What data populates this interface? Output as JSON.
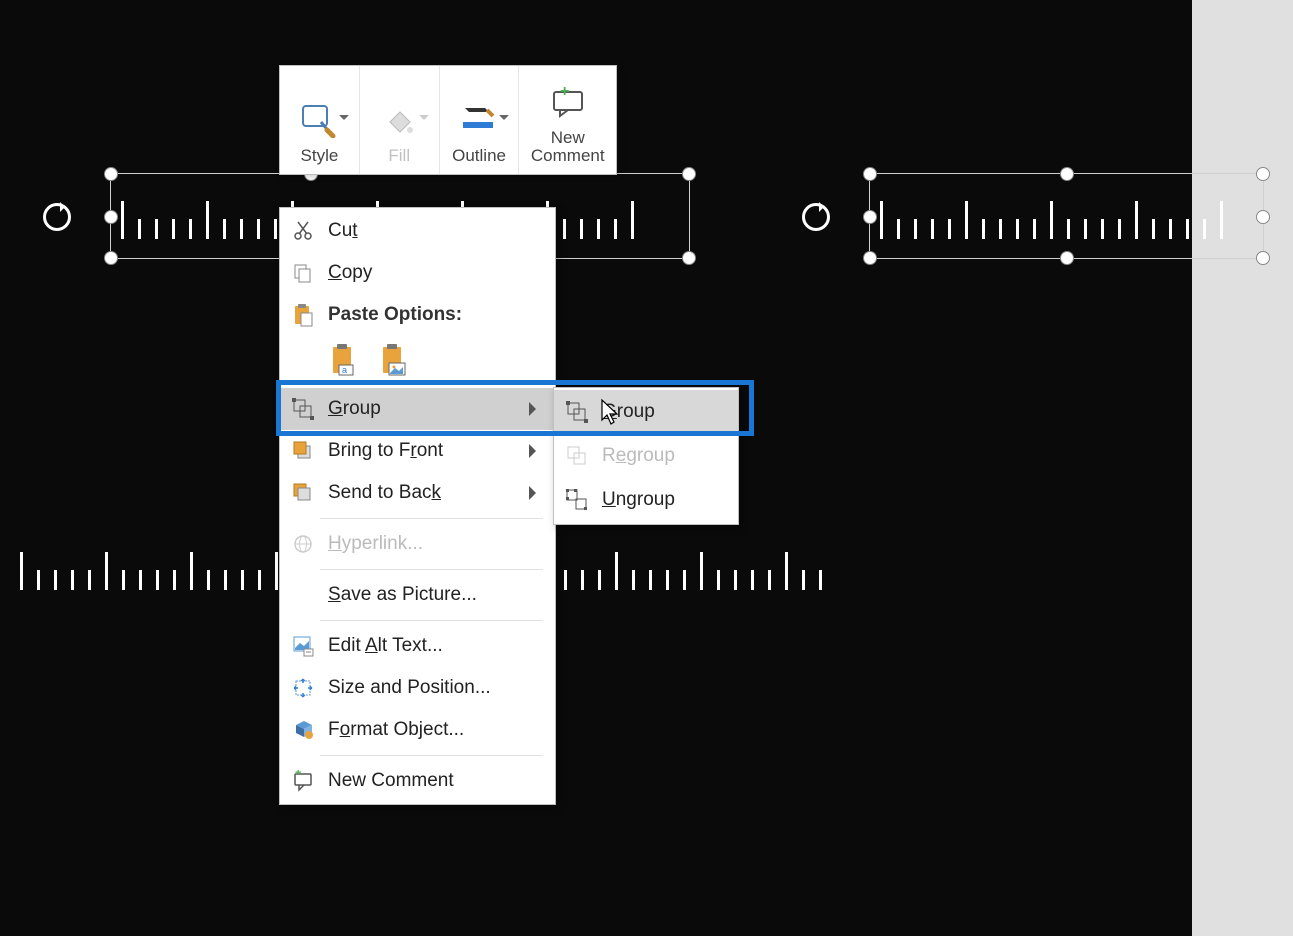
{
  "toolbar": {
    "style": "Style",
    "fill": "Fill",
    "outline": "Outline",
    "new_comment_line1": "New",
    "new_comment_line2": "Comment"
  },
  "context_menu": {
    "cut": "Cut",
    "copy": "Copy",
    "paste_options": "Paste Options:",
    "group": "Group",
    "bring_to_front": "Bring to Front",
    "send_to_back": "Send to Back",
    "hyperlink": "Hyperlink...",
    "save_as_picture": "Save as Picture...",
    "edit_alt_text": "Edit Alt Text...",
    "size_and_position": "Size and Position...",
    "format_object": "Format Object...",
    "new_comment": "New Comment"
  },
  "submenu": {
    "group": "Group",
    "regroup": "Regroup",
    "ungroup": "Ungroup"
  },
  "colors": {
    "highlight": "#1976d2",
    "canvas": "#0a0a0a",
    "menu_bg": "#ffffff",
    "hover_bg": "#d0d0d0"
  }
}
